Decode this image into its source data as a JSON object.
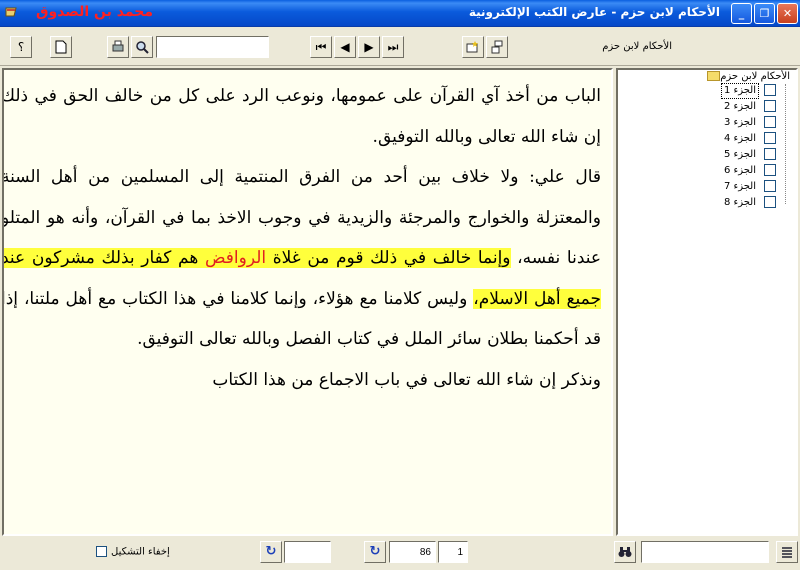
{
  "window": {
    "title": "الأحكام لابن حزم - عارض الكتب الإلكترونية",
    "author": "محمد بن الصدوق",
    "controls": {
      "minimize": "_",
      "restore": "❐",
      "close": "✕"
    }
  },
  "toolbar": {
    "help_label": "؟",
    "new_label": "",
    "first_label": "⏮",
    "prev_label": "◀",
    "next_label": "▶",
    "last_label": "⏭",
    "search_value": "",
    "book_label": "الأحكام لابن حزم"
  },
  "content": {
    "p1": "الباب من أخذ آي القرآن على عمومها، ونوعب الرد على كل من خالف الحق في ذلك إن شاء الله تعالى وبالله التوفيق.",
    "p2_a": "قال علي: ولا خلاف بين أحد من الفرق المنتمية إلى المسلمين من أهل السنة والمعتزلة والخوارج والمرجئة والزيدية في وجوب الاخذ بما في القرآن، وأنه هو المتلو عندنا نفسه، ",
    "p2_hl1": "وإنما خالف في ذلك قوم من غلاة ",
    "p2_red": "الروافض",
    "p2_hl2": " هم كفار بذلك مشركون عند جميع أهل الاسلام،",
    "p2_b": " وليس كلامنا مع هؤلاء، وإنما كلامنا في هذا الكتاب مع أهل ملتنا، إذا قد أحكمنا بطلان سائر الملل في كتاب الفصل وبالله تعالى التوفيق.",
    "p3": "ونذكر إن شاء الله تعالى في باب الاجماع من هذا الكتاب"
  },
  "tree": {
    "root": "الأحكام لابن حزم",
    "items": [
      {
        "label": "الجزء 1"
      },
      {
        "label": "الجزء 2"
      },
      {
        "label": "الجزء 3"
      },
      {
        "label": "الجزء 4"
      },
      {
        "label": "الجزء 5"
      },
      {
        "label": "الجزء 6"
      },
      {
        "label": "الجزء 7"
      },
      {
        "label": "الجزء 8"
      }
    ]
  },
  "status": {
    "tashkeel_label": "إخفاء التشكيل",
    "field1_value": "",
    "page_value": "86",
    "part_value": "1",
    "search_value": "",
    "go_label": "↻"
  }
}
